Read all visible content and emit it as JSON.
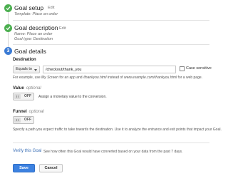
{
  "steps": {
    "goal_setup": {
      "title": "Goal setup",
      "edit": "Edit",
      "template_line": "Template: Place an order"
    },
    "goal_description": {
      "title": "Goal description",
      "edit": "Edit",
      "name_line": "Name: Place an order",
      "type_line": "Goal type: Destination"
    },
    "goal_details": {
      "number": "3",
      "title": "Goal details"
    }
  },
  "destination": {
    "label": "Destination",
    "match_type": "Equals to",
    "value": "/checkout/thank_you",
    "case_sensitive_label": "Case sensitive",
    "help_prefix": "For example, use ",
    "help_example_1": "My Screen",
    "help_middle_1": " for an app and ",
    "help_example_2": "/thankyou.html",
    "help_middle_2": " instead of ",
    "help_example_3": "www.example.com/thankyou.html",
    "help_suffix": " for a web page."
  },
  "value_section": {
    "label": "Value",
    "optional": "optional",
    "toggle_state": "OFF",
    "description": "Assign a monetary value to the conversion."
  },
  "funnel_section": {
    "label": "Funnel",
    "optional": "optional",
    "toggle_state": "OFF",
    "description": "Specify a path you expect traffic to take towards the destination. Use it to analyze the entrance and exit points that impact your Goal."
  },
  "verify": {
    "link": "Verify this Goal",
    "description": "See how often this Goal would have converted based on your data from the past 7 days."
  },
  "buttons": {
    "save": "Save",
    "cancel": "Cancel"
  },
  "colors": {
    "complete": "#4caf50",
    "current": "#3b7bd4",
    "primary_button": "#3d82e0",
    "link": "#3b6fb6"
  }
}
